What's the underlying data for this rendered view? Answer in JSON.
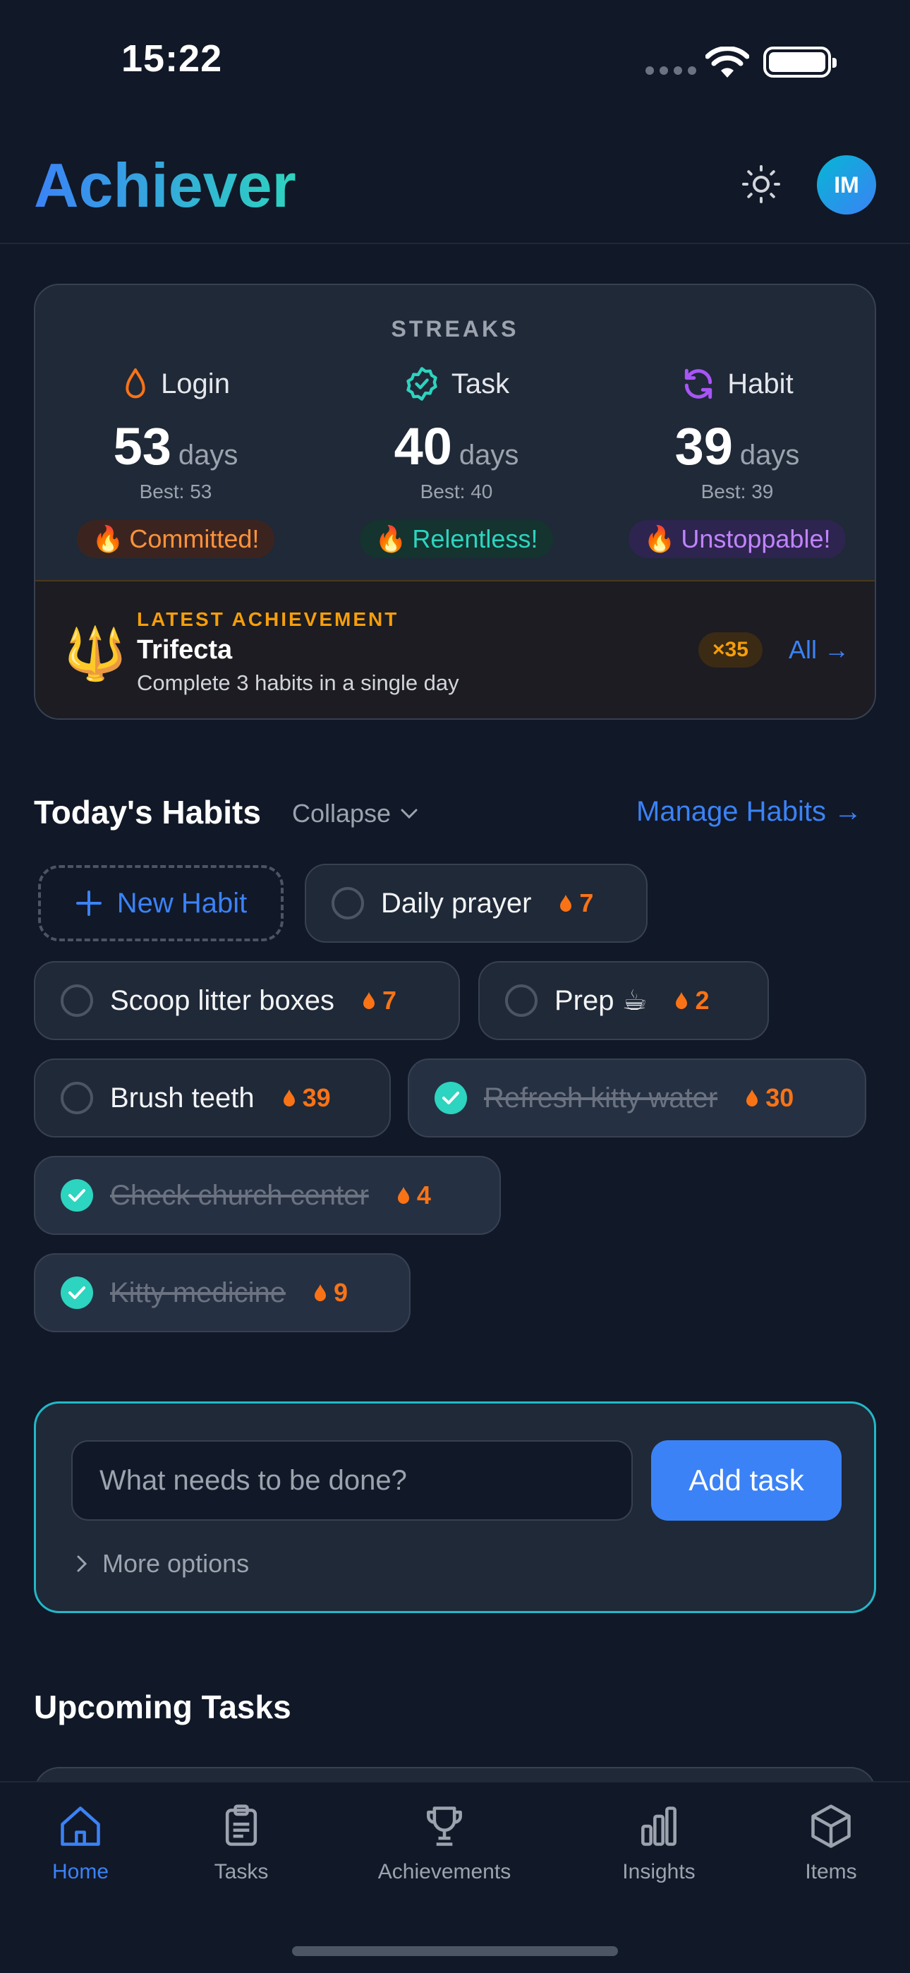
{
  "status_bar": {
    "time": "15:22"
  },
  "header": {
    "title": "Achiever",
    "avatar_initials": "IM"
  },
  "streaks": {
    "heading": "STREAKS",
    "items": [
      {
        "name": "Login",
        "value": "53",
        "unit": "days",
        "best": "Best: 53",
        "badge": "Committed!",
        "icon": "flame-outline-icon",
        "color": "#f97316"
      },
      {
        "name": "Task",
        "value": "40",
        "unit": "days",
        "best": "Best: 40",
        "badge": "Relentless!",
        "icon": "badge-check-icon",
        "color": "#2dd4bf"
      },
      {
        "name": "Habit",
        "value": "39",
        "unit": "days",
        "best": "Best: 39",
        "badge": "Unstoppable!",
        "icon": "refresh-icon",
        "color": "#a855f7"
      }
    ]
  },
  "achievement": {
    "label": "LATEST ACHIEVEMENT",
    "title": "Trifecta",
    "description": "Complete 3 habits in a single day",
    "count": "×35",
    "all_link": "All →",
    "icon": "trident-icon"
  },
  "habits": {
    "title": "Today's Habits",
    "collapse_label": "Collapse",
    "manage_link": "Manage Habits →",
    "new_habit_label": "New Habit",
    "items": [
      {
        "label": "Daily prayer",
        "streak": "7",
        "done": false
      },
      {
        "label": "Scoop litter boxes",
        "streak": "7",
        "done": false
      },
      {
        "label": "Prep ☕",
        "streak": "2",
        "done": false
      },
      {
        "label": "Brush teeth",
        "streak": "39",
        "done": false
      },
      {
        "label": "Refresh kitty water",
        "streak": "30",
        "done": true
      },
      {
        "label": "Check church center",
        "streak": "4",
        "done": true
      },
      {
        "label": "Kitty medicine",
        "streak": "9",
        "done": true
      }
    ]
  },
  "add_task": {
    "placeholder": "What needs to be done?",
    "button_label": "Add task",
    "more_options": "More options"
  },
  "upcoming": {
    "title": "Upcoming Tasks"
  },
  "nav": {
    "items": [
      {
        "label": "Home",
        "icon": "home-icon",
        "active": true
      },
      {
        "label": "Tasks",
        "icon": "clipboard-icon",
        "active": false
      },
      {
        "label": "Achievements",
        "icon": "trophy-icon",
        "active": false
      },
      {
        "label": "Insights",
        "icon": "bar-chart-icon",
        "active": false
      },
      {
        "label": "Items",
        "icon": "cube-icon",
        "active": false
      }
    ]
  },
  "colors": {
    "accent": "#3b82f6",
    "teal": "#2dd4bf",
    "streak": "#f97316",
    "gold": "#f59e0b"
  }
}
